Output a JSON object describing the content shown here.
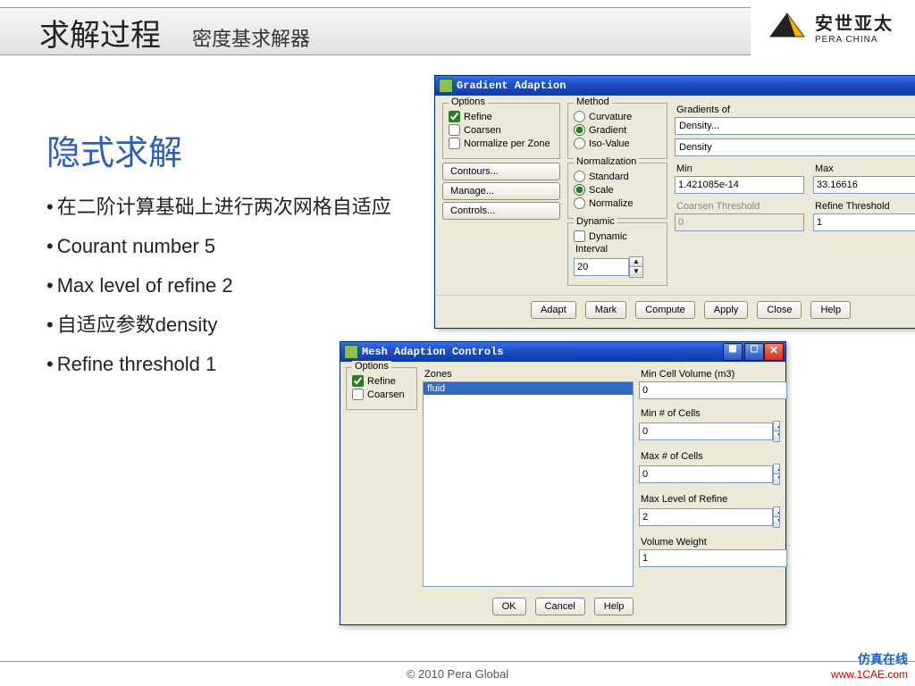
{
  "slide": {
    "title": "求解过程",
    "subtitle": "密度基求解器"
  },
  "logo": {
    "cn": "安世亚太",
    "en": "PERA CHINA"
  },
  "content": {
    "heading": "隐式求解",
    "bullets": [
      "在二阶计算基础上进行两次网格自适应",
      "Courant number 5",
      "Max level of refine 2",
      "自适应参数density",
      "Refine threshold 1"
    ]
  },
  "dlg1": {
    "title": "Gradient Adaption",
    "options": {
      "label": "Options",
      "items": [
        "Refine",
        "Coarsen",
        "Normalize per Zone"
      ]
    },
    "side_buttons": [
      "Contours...",
      "Manage...",
      "Controls..."
    ],
    "method": {
      "label": "Method",
      "items": [
        "Curvature",
        "Gradient",
        "Iso-Value"
      ],
      "selected": "Gradient"
    },
    "normalization": {
      "label": "Normalization",
      "items": [
        "Standard",
        "Scale",
        "Normalize"
      ],
      "selected": "Scale"
    },
    "dynamic": {
      "label": "Dynamic",
      "checkbox": "Dynamic",
      "interval_label": "Interval",
      "interval": "20"
    },
    "gradients_of": {
      "label": "Gradients of",
      "value1": "Density...",
      "value2": "Density"
    },
    "minmax": {
      "min_label": "Min",
      "min": "1.421085e-14",
      "max_label": "Max",
      "max": "33.16616"
    },
    "thresholds": {
      "coarsen_label": "Coarsen Threshold",
      "coarsen": "0",
      "refine_label": "Refine Threshold",
      "refine": "1"
    },
    "buttons": [
      "Adapt",
      "Mark",
      "Compute",
      "Apply",
      "Close",
      "Help"
    ]
  },
  "dlg2": {
    "title": "Mesh Adaption Controls",
    "options": {
      "label": "Options",
      "items": [
        "Refine",
        "Coarsen"
      ]
    },
    "zones": {
      "label": "Zones",
      "items": [
        "fluid"
      ]
    },
    "fields": [
      {
        "label": "Min Cell Volume (m3)",
        "value": "0"
      },
      {
        "label": "Min # of Cells",
        "value": "0"
      },
      {
        "label": "Max # of Cells",
        "value": "0"
      },
      {
        "label": "Max Level of Refine",
        "value": "2"
      },
      {
        "label": "Volume Weight",
        "value": "1"
      }
    ],
    "buttons": [
      "OK",
      "Cancel",
      "Help"
    ]
  },
  "footer": {
    "copyright": "© 2010 Pera Global",
    "watermark": {
      "line1": "仿真在线",
      "line2": "www.1CAE.com"
    }
  }
}
